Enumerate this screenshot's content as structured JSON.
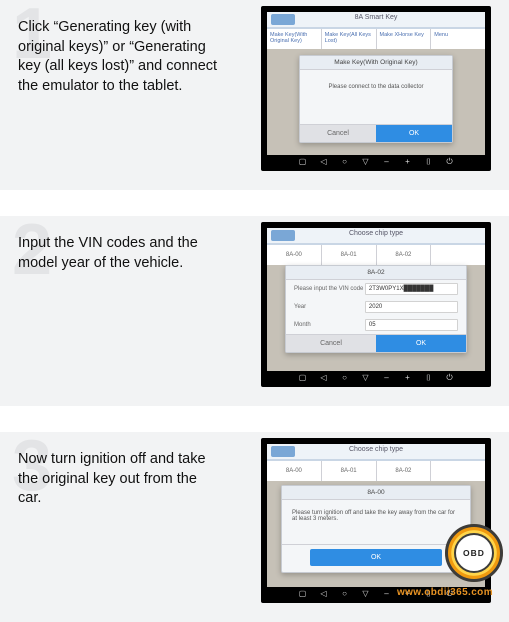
{
  "steps": [
    {
      "number": "1",
      "text": "Click “Generating key (with original keys)” or “Generating key (all keys lost)” and connect the emulator to the tablet.",
      "tablet": {
        "title": "8A Smart Key",
        "tabs": [
          "Make Key(With Original Key)",
          "Make Key(All Keys Lost)",
          "Make XHorse Key",
          "Menu"
        ],
        "dialog": {
          "title": "Make Key(With Original Key)",
          "message": "Please connect to the data collector",
          "cancel": "Cancel",
          "ok": "OK"
        }
      }
    },
    {
      "number": "2",
      "text": "Input the VIN codes and the model year of the vehicle.",
      "tablet": {
        "title": "Choose chip type",
        "chips": [
          "8A-00",
          "8A-01",
          "8A-02"
        ],
        "dialog": {
          "title": "8A-02",
          "vin_label": "Please input the VIN code",
          "vin_value": "2T3W0PY1X███████",
          "year_label": "Year",
          "year_value": "2020",
          "month_label": "Month",
          "month_value": "05",
          "cancel": "Cancel",
          "ok": "OK"
        }
      }
    },
    {
      "number": "3",
      "text": "Now turn ignition off and take the original key out from the car.",
      "tablet": {
        "title": "Choose chip type",
        "chips": [
          "8A-00",
          "8A-01",
          "8A-02"
        ],
        "dialog": {
          "title": "8A-00",
          "message": "Please turn ignition off and take the key away from the car for at least 3 meters.",
          "ok": "OK"
        }
      }
    }
  ],
  "watermark": {
    "badge": "OBD",
    "url": "www.obdii365.com"
  }
}
